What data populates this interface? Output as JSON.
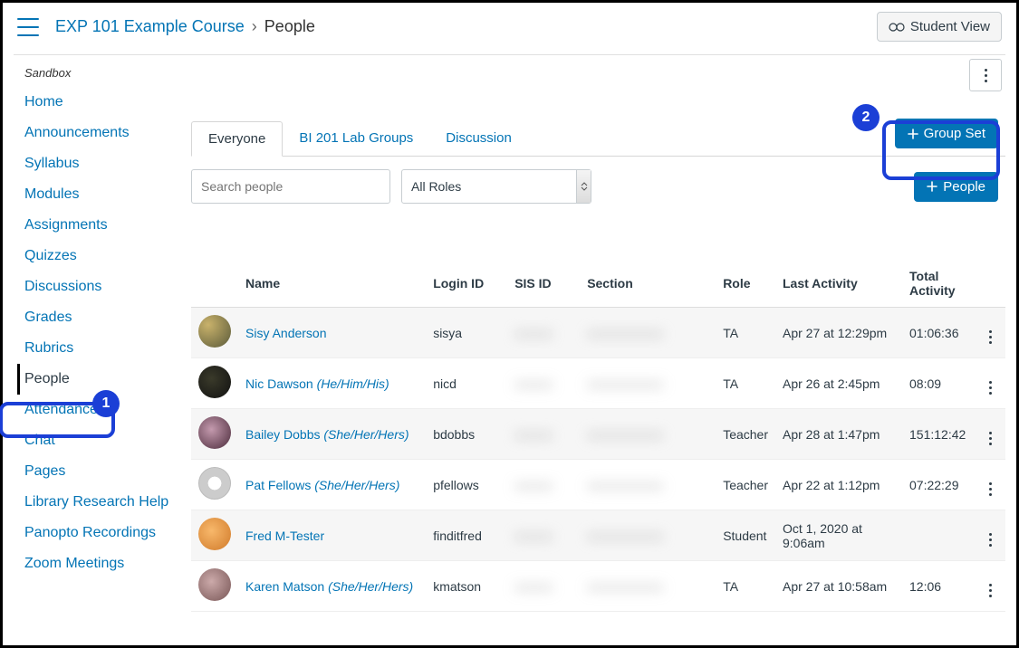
{
  "header": {
    "course": "EXP 101 Example Course",
    "page": "People",
    "student_view": "Student View"
  },
  "sandbox": "Sandbox",
  "sidebar": {
    "items": [
      {
        "label": "Home"
      },
      {
        "label": "Announcements"
      },
      {
        "label": "Syllabus"
      },
      {
        "label": "Modules"
      },
      {
        "label": "Assignments"
      },
      {
        "label": "Quizzes"
      },
      {
        "label": "Discussions"
      },
      {
        "label": "Grades"
      },
      {
        "label": "Rubrics"
      },
      {
        "label": "People"
      },
      {
        "label": "Attendance"
      },
      {
        "label": "Chat"
      },
      {
        "label": "Pages"
      },
      {
        "label": "Library Research Help"
      },
      {
        "label": "Panopto Recordings"
      },
      {
        "label": "Zoom Meetings"
      }
    ]
  },
  "tabs": {
    "everyone": "Everyone",
    "lab": "BI 201 Lab Groups",
    "disc": "Discussion"
  },
  "buttons": {
    "group_set": "Group Set",
    "people": "People"
  },
  "filter": {
    "search_placeholder": "Search people",
    "role_label": "All Roles"
  },
  "table": {
    "headers": {
      "name": "Name",
      "login": "Login ID",
      "sis": "SIS ID",
      "section": "Section",
      "role": "Role",
      "last": "Last Activity",
      "total": "Total Activity"
    },
    "rows": [
      {
        "name": "Sisy Anderson",
        "pronoun": "",
        "login": "sisya",
        "role": "TA",
        "last": "Apr 27 at 12:29pm",
        "total": "01:06:36"
      },
      {
        "name": "Nic Dawson",
        "pronoun": "(He/Him/His)",
        "login": "nicd",
        "role": "TA",
        "last": "Apr 26 at 2:45pm",
        "total": "08:09"
      },
      {
        "name": "Bailey Dobbs",
        "pronoun": "(She/Her/Hers)",
        "login": "bdobbs",
        "role": "Teacher",
        "last": "Apr 28 at 1:47pm",
        "total": "151:12:42"
      },
      {
        "name": "Pat Fellows",
        "pronoun": "(She/Her/Hers)",
        "login": "pfellows",
        "role": "Teacher",
        "last": "Apr 22 at 1:12pm",
        "total": "07:22:29"
      },
      {
        "name": "Fred M-Tester",
        "pronoun": "",
        "login": "finditfred",
        "role": "Student",
        "last": "Oct 1, 2020 at 9:06am",
        "total": ""
      },
      {
        "name": "Karen Matson",
        "pronoun": "(She/Her/Hers)",
        "login": "kmatson",
        "role": "TA",
        "last": "Apr 27 at 10:58am",
        "total": "12:06"
      }
    ]
  },
  "annotations": {
    "one": "1",
    "two": "2"
  }
}
